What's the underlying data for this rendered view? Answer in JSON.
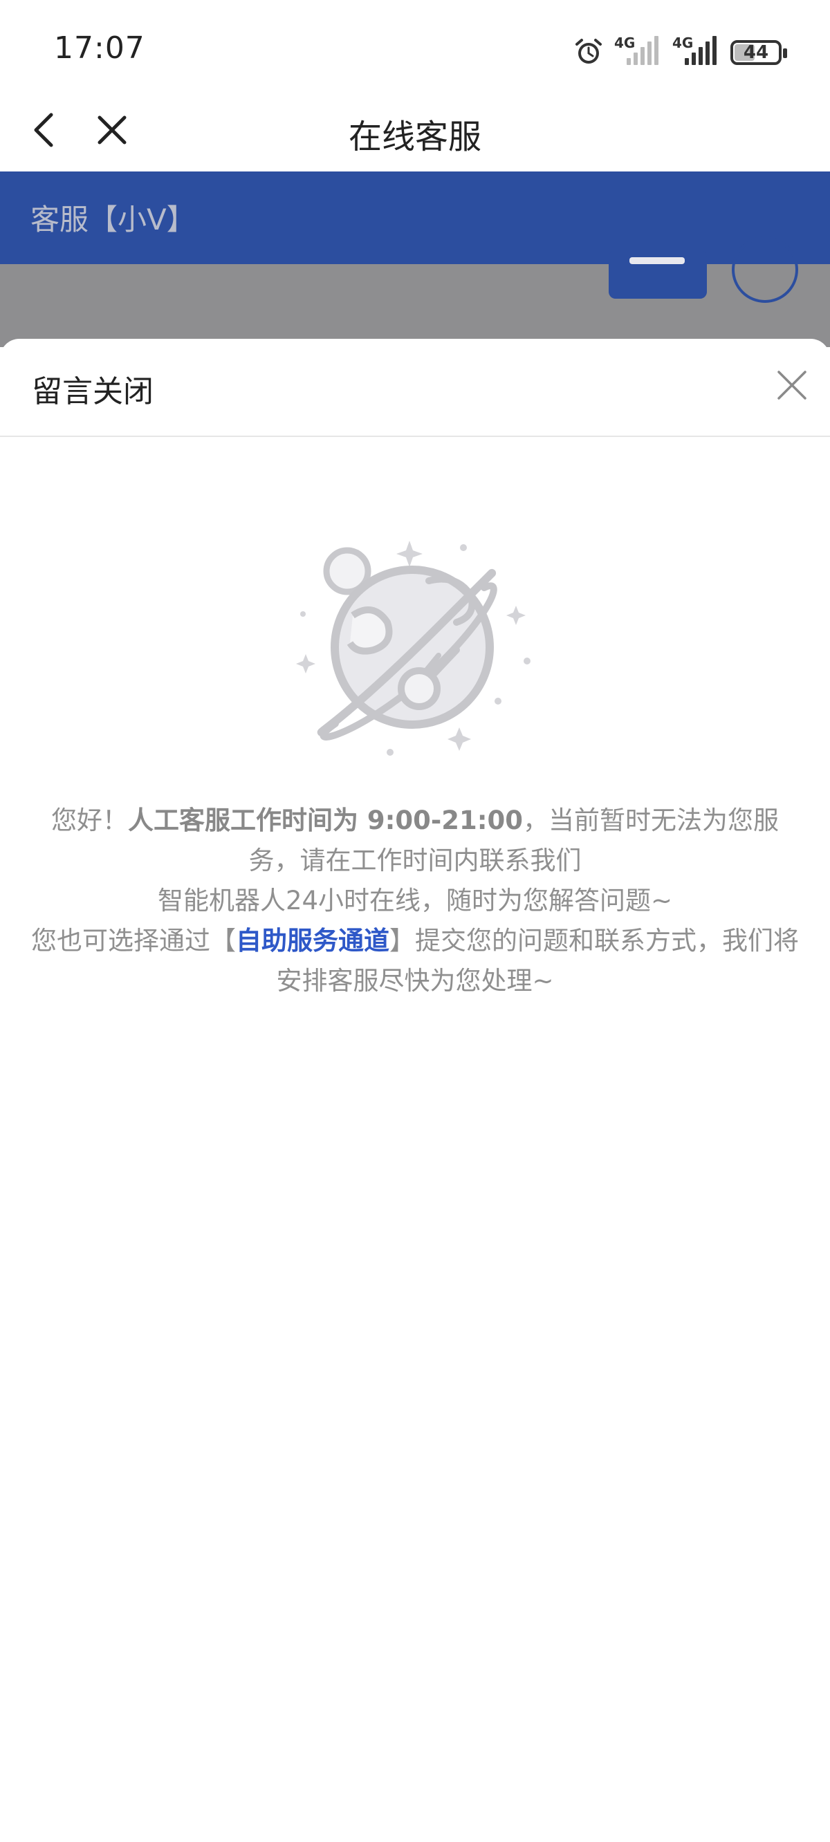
{
  "status_bar": {
    "time": "17:07",
    "signal_1_label": "4G",
    "signal_2_label": "4G",
    "battery": "44",
    "icons": [
      "alarm-icon",
      "signal-icon",
      "signal-icon",
      "battery-icon"
    ]
  },
  "nav": {
    "title": "在线客服",
    "back_icon": "chevron-left-icon",
    "close_icon": "close-icon"
  },
  "chat_header": {
    "title": "客服【小V】",
    "color": "#2c4e9f"
  },
  "sheet": {
    "title": "留言关闭",
    "close_icon": "close-icon",
    "illustration_icon": "planet-icon",
    "message": {
      "greeting": "您好！",
      "hours_strong": "人工客服工作时间为 9:00-21:00",
      "line1_rest": "，当前暂时无法为您服务，请在工作时间内联系我们",
      "line2": "智能机器人24小时在线，随时为您解答问题~",
      "line3_prefix": "您也可选择通过【",
      "link_text": "自助服务通道",
      "line3_suffix": "】提交您的问题和联系方式，我们将安排客服尽快为您处理~",
      "link_color": "#2e58c8"
    }
  }
}
